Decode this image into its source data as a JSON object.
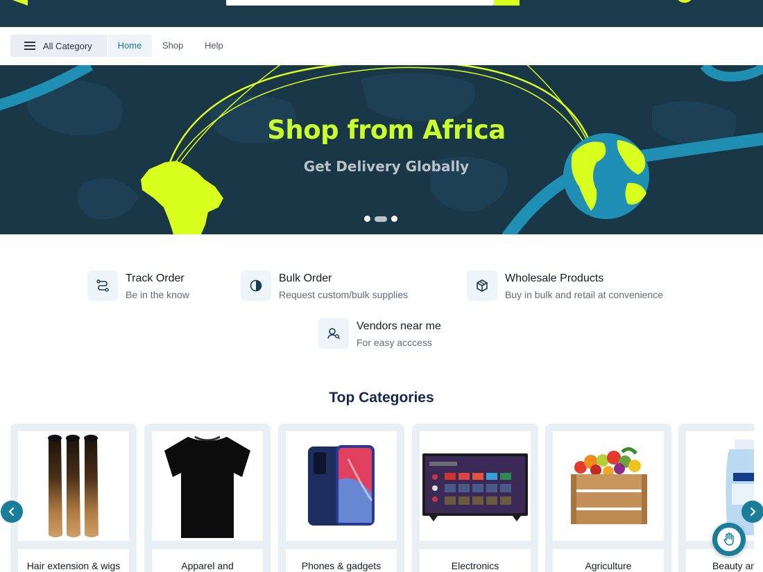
{
  "nav": {
    "category_label": "All Category",
    "links": [
      "Home",
      "Shop",
      "Help"
    ],
    "active": "Home"
  },
  "hero": {
    "title": "Shop from Africa",
    "subtitle": "Get Delivery Globally",
    "slides": 3,
    "active_slide": 2
  },
  "features": [
    {
      "icon": "route-icon",
      "title": "Track Order",
      "subtitle": "Be in the know"
    },
    {
      "icon": "half-circle-icon",
      "title": "Bulk Order",
      "subtitle": "Request custom/bulk supplies"
    },
    {
      "icon": "box-icon",
      "title": "Wholesale Products",
      "subtitle": "Buy in bulk and retail at convenience"
    },
    {
      "icon": "vendor-search-icon",
      "title": "Vendors near me",
      "subtitle": "For easy acccess"
    }
  ],
  "categories_title": "Top Categories",
  "categories": [
    {
      "label": "Hair extension & wigs",
      "icon": "hair-extension-image"
    },
    {
      "label": "Apparel and",
      "icon": "tshirt-image"
    },
    {
      "label": "Phones & gadgets",
      "icon": "smartphone-image"
    },
    {
      "label": "Electronics",
      "icon": "television-image"
    },
    {
      "label": "Agriculture",
      "icon": "produce-crate-image"
    },
    {
      "label": "Beauty and P",
      "icon": "lotion-bottle-image"
    }
  ],
  "colors": {
    "brand_dark": "#1b3a4b",
    "accent_lime": "#d8ff1e",
    "accent_teal": "#1a7e9a"
  }
}
